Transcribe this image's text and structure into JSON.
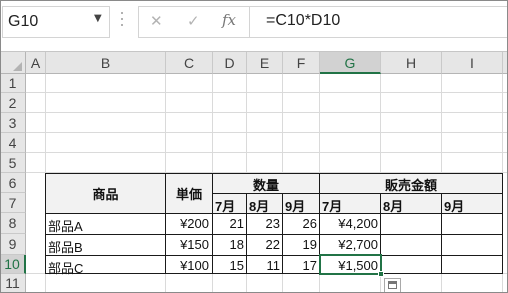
{
  "name_box": {
    "value": "G10"
  },
  "formula_bar": {
    "cancel_glyph": "✕",
    "enter_glyph": "✓",
    "fx_label": "fx",
    "formula": "=C10*D10"
  },
  "columns": [
    "A",
    "B",
    "C",
    "D",
    "E",
    "F",
    "G",
    "H",
    "I"
  ],
  "rows": [
    "1",
    "2",
    "3",
    "4",
    "5",
    "6",
    "7",
    "8",
    "9",
    "10",
    "11"
  ],
  "selected": {
    "column": "G",
    "row": "10"
  },
  "table": {
    "header_product": "商品",
    "header_price": "単価",
    "header_quantity": "数量",
    "header_sales": "販売金額",
    "months": [
      "7月",
      "8月",
      "9月"
    ],
    "items": [
      {
        "name": "部品A",
        "price": "¥200",
        "q7": "21",
        "q8": "23",
        "q9": "26",
        "s7": "¥4,200",
        "s8": "",
        "s9": ""
      },
      {
        "name": "部品B",
        "price": "¥150",
        "q7": "18",
        "q8": "22",
        "q9": "19",
        "s7": "¥2,700",
        "s8": "",
        "s9": ""
      },
      {
        "name": "部品C",
        "price": "¥100",
        "q7": "15",
        "q8": "11",
        "q9": "17",
        "s7": "¥1,500",
        "s8": "",
        "s9": ""
      }
    ]
  },
  "colors": {
    "accent": "#217346",
    "header_fill": "#f2f2f2"
  }
}
